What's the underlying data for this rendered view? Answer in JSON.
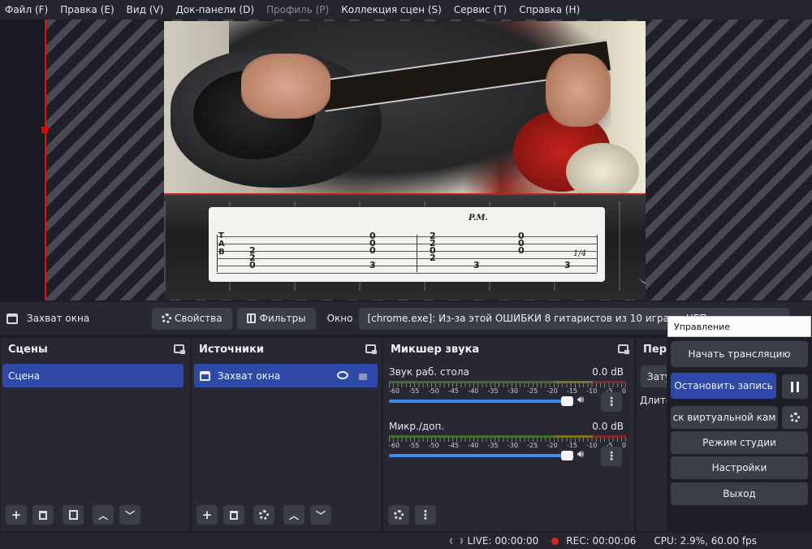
{
  "menu": [
    "Файл (F)",
    "Правка (E)",
    "Вид (V)",
    "Док-панели (D)",
    "Профиль (P)",
    "Коллекция сцен (S)",
    "Сервис (T)",
    "Справка (H)"
  ],
  "source_toolbar": {
    "source_name": "Захват окна",
    "properties": "Свойства",
    "filters": "Фильтры",
    "window_label": "Окно",
    "window_value": "[chrome.exe]: Из-за этой ОШИБКИ 8 гитаристов из 10 играют НЕП"
  },
  "tab_overlay": {
    "pm": "P.M.",
    "clef": [
      "T",
      "A",
      "B"
    ],
    "quarter": "1/4",
    "notes": [
      "2",
      "2",
      "0",
      "0",
      "0",
      "3",
      "2",
      "2",
      "0",
      "0",
      "0",
      "3",
      "0",
      "0",
      "2",
      "3"
    ]
  },
  "scenes": {
    "title": "Сцены",
    "items": [
      "Сцена"
    ]
  },
  "sources": {
    "title": "Источники",
    "items": [
      "Захват окна"
    ]
  },
  "mixer": {
    "title": "Микшер звука",
    "channels": [
      {
        "name": "Звук раб. стола",
        "db": "0.0 dB",
        "level": 0.96
      },
      {
        "name": "Микр./доп.",
        "db": "0.0 dB",
        "level": 0.96
      }
    ],
    "scale": [
      "-60",
      "-55",
      "-50",
      "-45",
      "-40",
      "-35",
      "-30",
      "-25",
      "-20",
      "-15",
      "-10",
      "-5",
      "0"
    ]
  },
  "transitions": {
    "title": "Перех",
    "selected": "Зату",
    "duration_label": "Длите"
  },
  "controls": {
    "tooltip": "Управление",
    "start_stream": "Начать трансляцию",
    "stop_record": "Остановить запись",
    "virtual_cam": "ск виртуальной кам",
    "studio_mode": "Режим студии",
    "settings": "Настройки",
    "exit": "Выход"
  },
  "status": {
    "live": "LIVE: 00:00:00",
    "rec": "REC: 00:00:06",
    "cpu": "CPU: 2.9%, 60.00 fps"
  },
  "colors": {
    "accent": "#2e49a8",
    "recording": "#d72424",
    "slider": "#3d8af0"
  }
}
